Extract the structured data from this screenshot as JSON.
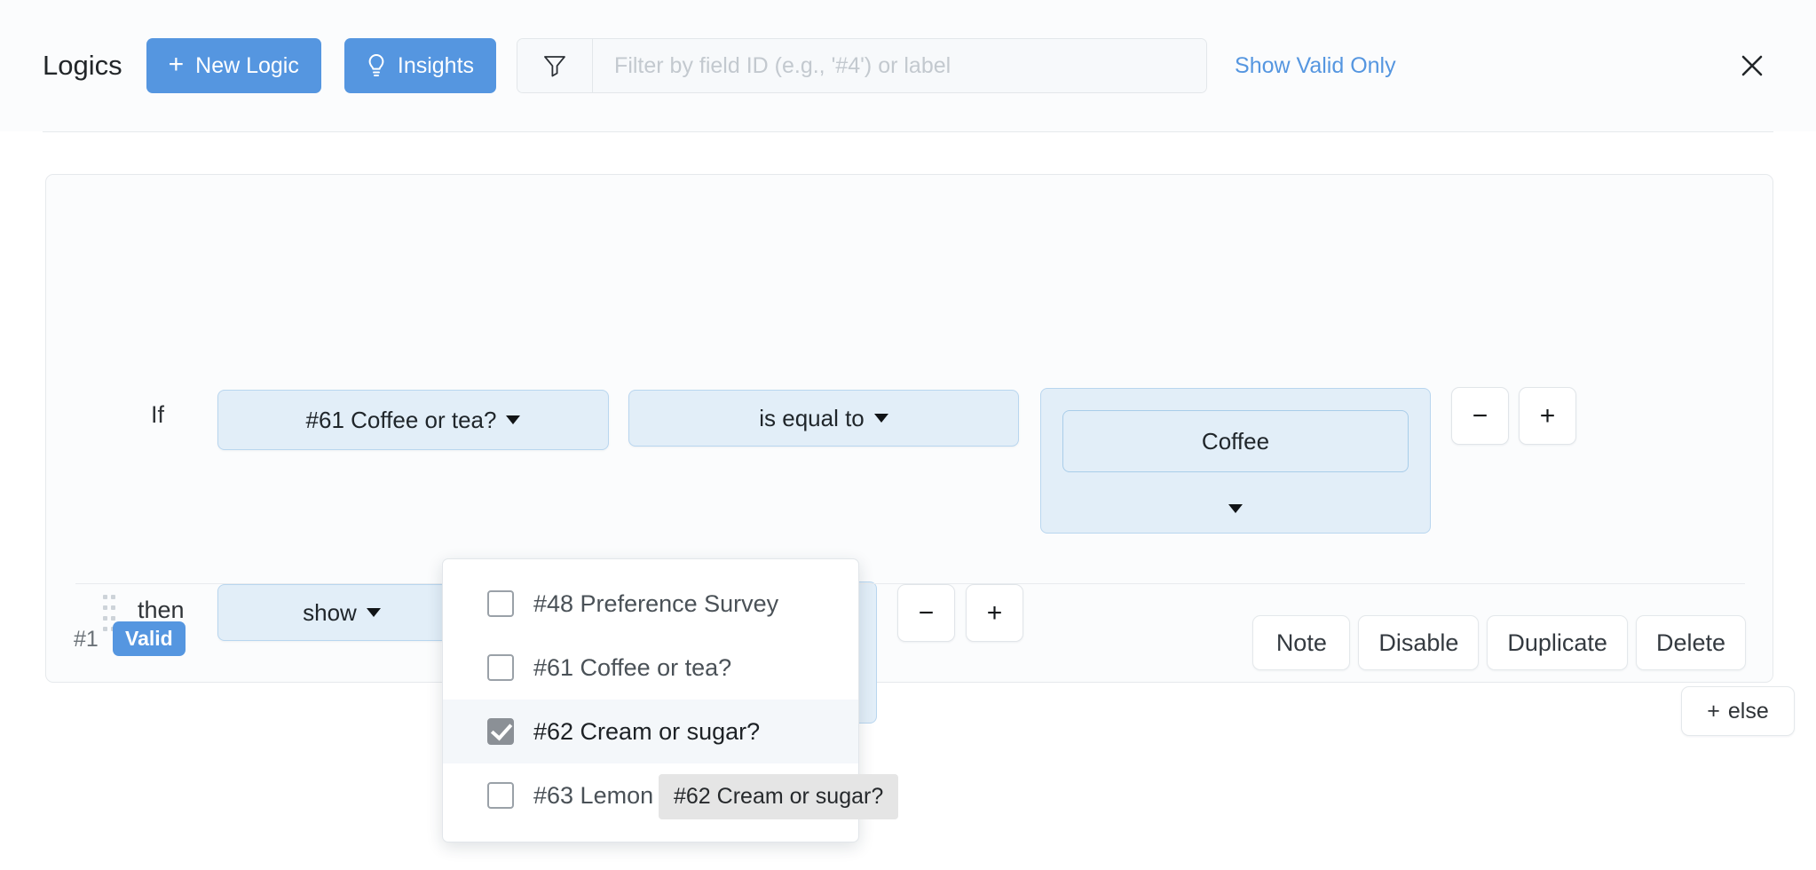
{
  "header": {
    "title": "Logics",
    "new_logic_label": "New Logic",
    "new_logic_icon": "plus-icon",
    "insights_label": "Insights",
    "insights_icon": "lightbulb-icon",
    "filter_icon": "funnel-icon",
    "filter_placeholder": "Filter by field ID (e.g., '#4') or label",
    "filter_value": "",
    "show_valid_only_label": "Show Valid Only",
    "close_icon": "close-icon",
    "accent_color": "#5596e0"
  },
  "logic": {
    "if_label": "If",
    "then_label": "then",
    "field_select": "#61 Coffee or tea?",
    "operator_select": "is equal to",
    "value_select": "Coffee",
    "action_select": "show",
    "target_select": "#62 Cream or sugar?",
    "minus_label": "−",
    "plus_label": "+",
    "else_label": "else",
    "else_plus": "+",
    "number": "#1",
    "status": "Valid",
    "status_color": "#5596e0",
    "actions": [
      "Note",
      "Disable",
      "Duplicate",
      "Delete"
    ]
  },
  "dropdown": {
    "options": [
      {
        "label": "#48 Preference Survey",
        "checked": false
      },
      {
        "label": "#61 Coffee or tea?",
        "checked": false
      },
      {
        "label": "#62 Cream or sugar?",
        "checked": true
      },
      {
        "label": "#63 Lemon or honey?",
        "checked": false
      }
    ]
  },
  "tooltip": {
    "text": "#62 Cream or sugar?"
  }
}
